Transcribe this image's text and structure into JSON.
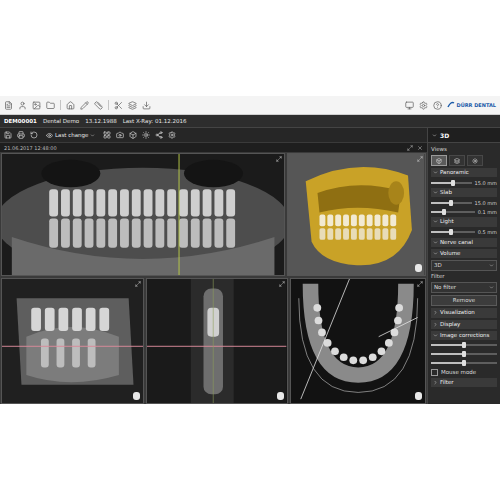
{
  "logo": "DÜRR DENTAL",
  "patient_bar": {
    "id": "DEM00001",
    "name": "Dental Demo",
    "birth": "13.12.1988",
    "last_xray": "Last X-Ray: 01.12.2016"
  },
  "view_toolbar": {
    "dropdown": "Last change"
  },
  "timestamp": "21.06.2017 12:48:00",
  "viewports": {
    "top": [
      {
        "kind": "panoramic"
      },
      {
        "kind": "volume"
      }
    ],
    "bottom": [
      {
        "kind": "sagittal"
      },
      {
        "kind": "cross"
      },
      {
        "kind": "axial"
      }
    ]
  },
  "side_panel": {
    "title": "3D",
    "items": [
      {
        "kind": "label",
        "text": "Views"
      },
      {
        "kind": "modes",
        "modes": [
          {
            "selected": true
          },
          {
            "selected": false
          },
          {
            "selected": false
          }
        ]
      },
      {
        "kind": "section",
        "text": "Panoramic",
        "expanded": true
      },
      {
        "kind": "slider",
        "reading": "15.0 mm",
        "level": 0.55
      },
      {
        "kind": "section",
        "text": "Slab",
        "expanded": true
      },
      {
        "kind": "slider",
        "reading": "15.0 mm",
        "level": 0.5
      },
      {
        "kind": "slider",
        "reading": "0.1 mm",
        "level": 0.3
      },
      {
        "kind": "section",
        "text": "Light",
        "expanded": true
      },
      {
        "kind": "slider",
        "reading": "0.5 mm",
        "level": 0.45
      },
      {
        "kind": "section",
        "text": "Nerve canal",
        "expanded": true
      },
      {
        "kind": "section",
        "text": "Volume",
        "expanded": true
      },
      {
        "kind": "dropdown",
        "text": "3D"
      },
      {
        "kind": "label",
        "text": "Filter"
      },
      {
        "kind": "dropdown",
        "text": "No filter"
      },
      {
        "kind": "button",
        "text": "Remove"
      },
      {
        "kind": "section",
        "text": "Visualization",
        "expanded": false
      },
      {
        "kind": "section",
        "text": "Display",
        "expanded": false
      },
      {
        "kind": "section",
        "text": "Image corrections",
        "expanded": true
      },
      {
        "kind": "slider",
        "reading": "",
        "level": 0.5
      },
      {
        "kind": "slider",
        "reading": "",
        "level": 0.5
      },
      {
        "kind": "slider",
        "reading": "",
        "level": 0.5
      },
      {
        "kind": "check",
        "text": "Mouse mode",
        "checked": false
      },
      {
        "kind": "section",
        "text": "Filter",
        "expanded": false
      }
    ]
  }
}
